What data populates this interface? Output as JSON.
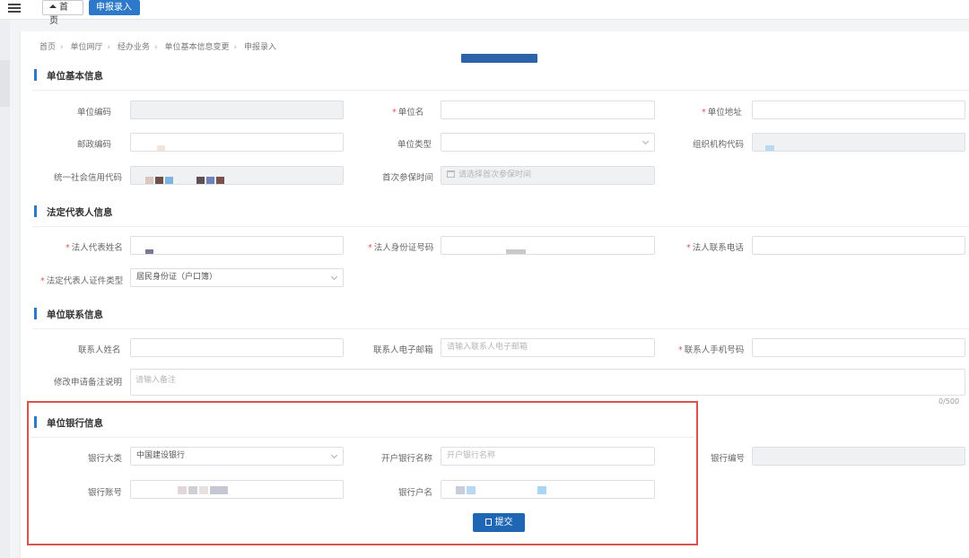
{
  "tabs": {
    "home": "首页",
    "active": "申报录入"
  },
  "breadcrumb": [
    "首页",
    "单位网厅",
    "经办业务",
    "单位基本信息变更",
    "申报录入"
  ],
  "sections": {
    "basic": "单位基本信息",
    "legal": "法定代表人信息",
    "contact": "单位联系信息",
    "bank": "单位银行信息"
  },
  "basic": {
    "unit_code_label": "单位编码",
    "unit_name_label": "单位名",
    "unit_address_label": "单位地址",
    "postal_code_label": "邮政编码",
    "unit_type_label": "单位类型",
    "org_code_label": "组织机构代码",
    "credit_code_label": "统一社会信用代码",
    "first_insured_label": "首次参保时间",
    "first_insured_placeholder": "请选择首次参保时间"
  },
  "legal": {
    "name_label": "法人代表姓名",
    "id_label": "法人身份证号码",
    "phone_label": "法人联系电话",
    "cert_type_label": "法定代表人证件类型",
    "cert_type_value": "居民身份证（户口簿）"
  },
  "contact": {
    "name_label": "联系人姓名",
    "email_label": "联系人电子邮箱",
    "email_placeholder": "请输入联系人电子邮箱",
    "mobile_label": "联系人手机号码",
    "remark_label": "修改申请备注说明",
    "remark_placeholder": "请输入备注",
    "counter": "0/500"
  },
  "bank": {
    "category_label": "银行大类",
    "category_value": "中国建设银行",
    "branch_label": "开户银行名称",
    "branch_placeholder": "开户银行名称",
    "code_label": "银行编号",
    "account_label": "银行账号",
    "holder_label": "银行户名",
    "submit": "提交"
  },
  "colors": {
    "accent": "#2d78c8",
    "highlight": "#d9534f",
    "button": "#1f66b5"
  }
}
